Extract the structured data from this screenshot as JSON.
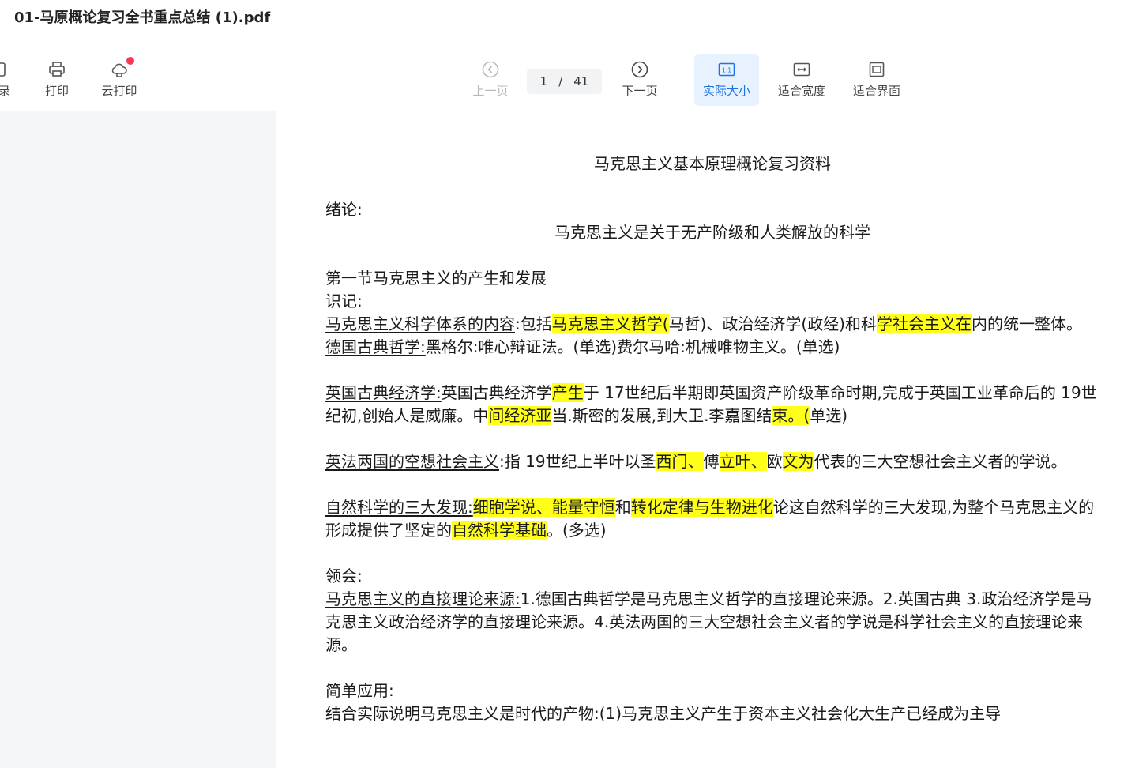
{
  "window": {
    "title": "01-马原概论复习全书重点总结 (1).pdf"
  },
  "toolbar": {
    "toc_label": "目录",
    "print_label": "打印",
    "cloud_print_label": "云打印",
    "prev_label": "上一页",
    "next_label": "下一页",
    "page_current": "1",
    "page_sep": "/",
    "page_total": "41",
    "actual_size_label": "实际大小",
    "fit_width_label": "适合宽度",
    "fit_page_label": "适合界面"
  },
  "colors": {
    "accent": "#1a73e8",
    "highlight": "#ffff1a",
    "badge": "#f5394e"
  },
  "document": {
    "title": "马克思主义基本原理概论复习资料",
    "intro_label": "绪论:",
    "intro_subtitle": "马克思主义是关于无产阶级和人类解放的科学",
    "section1": "第一节马克思主义的产生和发展",
    "recall_label": "识记:",
    "p1_term": "马克思主义科学体系的内容",
    "p1_a": ":包括",
    "p1_h1": "马克思主义哲学(",
    "p1_b": "马哲)、政治经济学(政经)和科",
    "p1_h2": "学社会主义在",
    "p1_c": "内的统一整体。",
    "p2_term": "德国古典哲学:",
    "p2_text": "黑格尔:唯心辩证法。(单选)费尔马哈:机械唯物主义。(单选)",
    "p3_term": "英国古典经济学:",
    "p3_a": "英国古典经济学",
    "p3_h1": "产生",
    "p3_b": "于 17世纪后半期即英国资产阶级革命时期,完成于英国工业革命后的 19世纪初,创始人是威廉。中",
    "p3_h2": "间经济亚",
    "p3_c": "当.斯密的发展,到大卫.李嘉图结",
    "p3_h3": "束。(",
    "p3_d": "单选)",
    "p4_term": "英法两国的空想社会主义",
    "p4_a": ":指 19世纪上半叶以圣",
    "p4_h1": "西门、",
    "p4_b": "傅",
    "p4_h2": "立叶、",
    "p4_c": "欧",
    "p4_h3": "文为",
    "p4_d": "代表的三大空想社会主义者的学说。",
    "p5_term": "自然科学的三大发现:",
    "p5_h1": "细胞学说、能量守恒",
    "p5_a": "和",
    "p5_h2": "转化定律与生物进化",
    "p5_b": "论这自然科学的三大发现,为整个马克思主义的形成提供了坚定的",
    "p5_h3": "自然科学基础",
    "p5_c": "。(多选)",
    "understand_label": "领会:",
    "p6_term": "马克思主义的直接理论来源:",
    "p6_text": "1.德国古典哲学是马克思主义哲学的直接理论来源。2.英国古典 3.政治经济学是马克思主义政治经济学的直接理论来源。4.英法两国的三大空想社会主义者的学说是科学社会主义的直接理论来源。",
    "apply_label": "简单应用:",
    "p7_text": "结合实际说明马克思主义是时代的产物:(1)马克思主义产生于资本主义社会化大生产已经成为主导"
  }
}
